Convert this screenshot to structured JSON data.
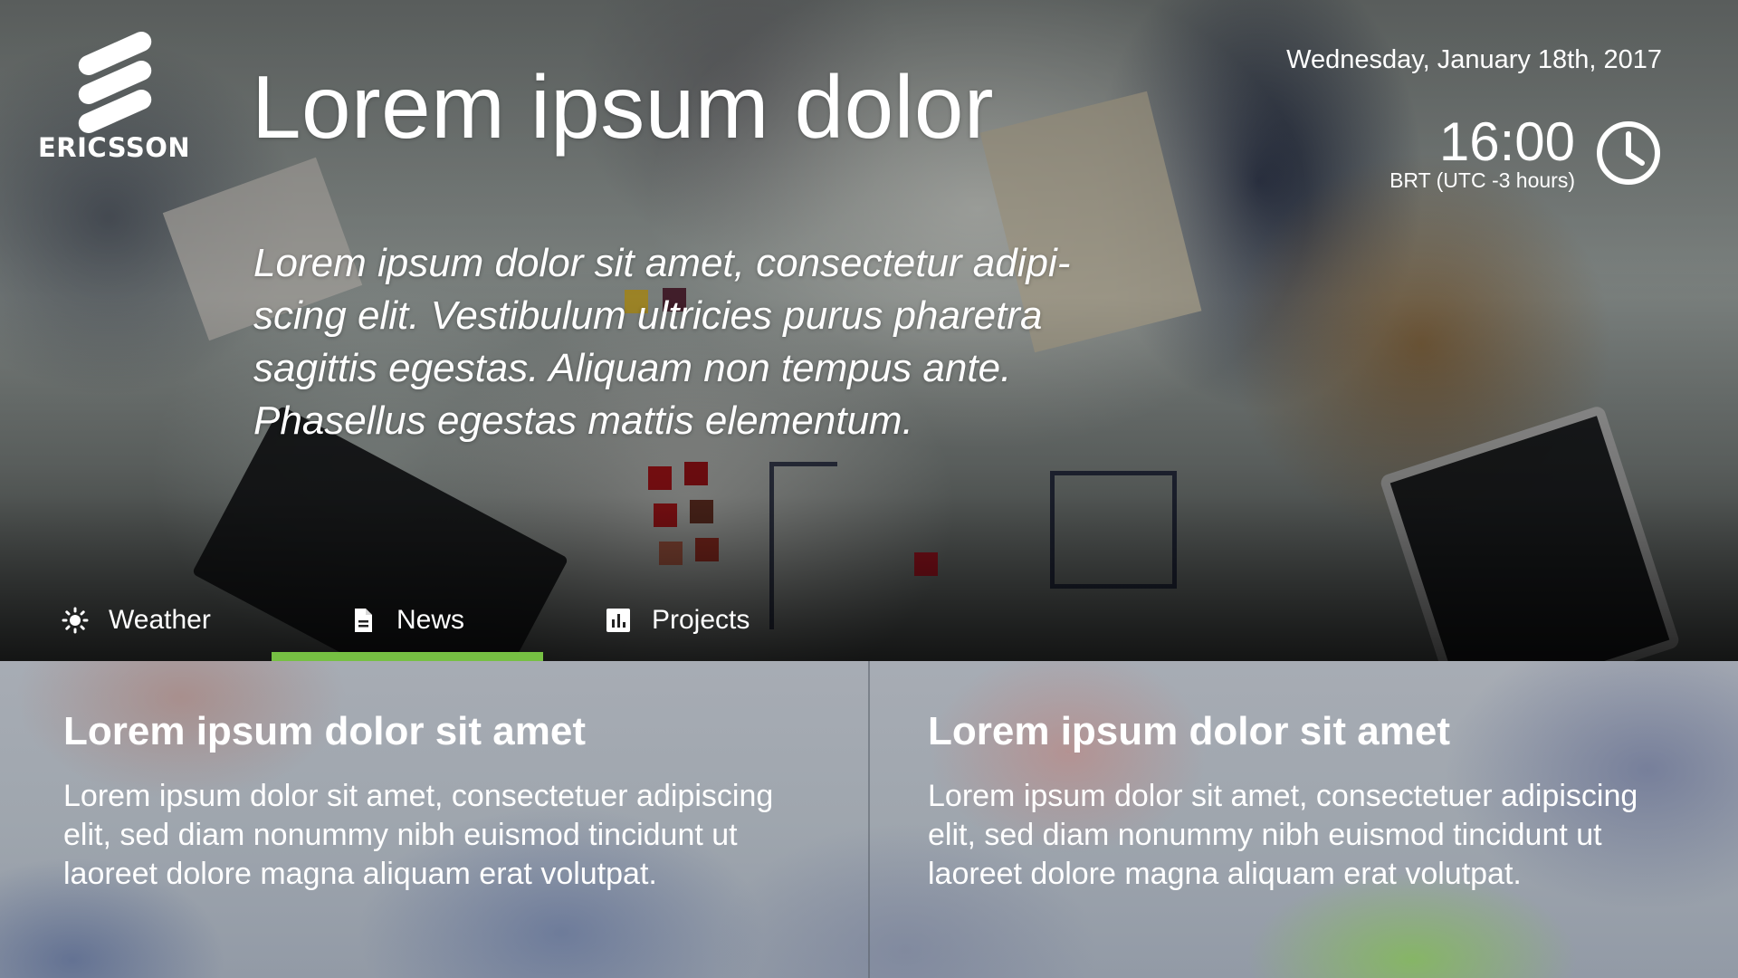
{
  "brand": {
    "name": "ERICSSON"
  },
  "header": {
    "title": "Lorem ipsum dolor",
    "lead": "Lorem ipsum dolor sit amet, consectetur adipi-scing elit. Vestibulum ultricies purus pharetra sagittis egestas. Aliquam non tempus ante. Phasellus egestas mattis elementum."
  },
  "datetime": {
    "date": "Wednesday, January 18th, 2017",
    "time": "16:00",
    "timezone": "BRT (UTC -3 hours)",
    "icon": "clock-icon"
  },
  "tabs": [
    {
      "label": "Weather",
      "icon": "sun-icon",
      "active": false
    },
    {
      "label": "News",
      "icon": "document-icon",
      "active": true
    },
    {
      "label": "Projects",
      "icon": "bar-chart-icon",
      "active": false
    }
  ],
  "colors": {
    "accent": "#76c043",
    "text": "#ffffff"
  },
  "news": [
    {
      "title": "Lorem ipsum dolor sit amet",
      "body": "Lorem ipsum dolor sit amet, consectetuer adipiscing elit, sed diam nonummy nibh euismod tincidunt ut laoreet dolore magna aliquam erat volutpat."
    },
    {
      "title": "Lorem ipsum dolor sit amet",
      "body": "Lorem ipsum dolor sit amet, consectetuer adipiscing elit, sed diam nonummy nibh euismod tincidunt ut laoreet dolore magna aliquam erat volutpat."
    }
  ]
}
